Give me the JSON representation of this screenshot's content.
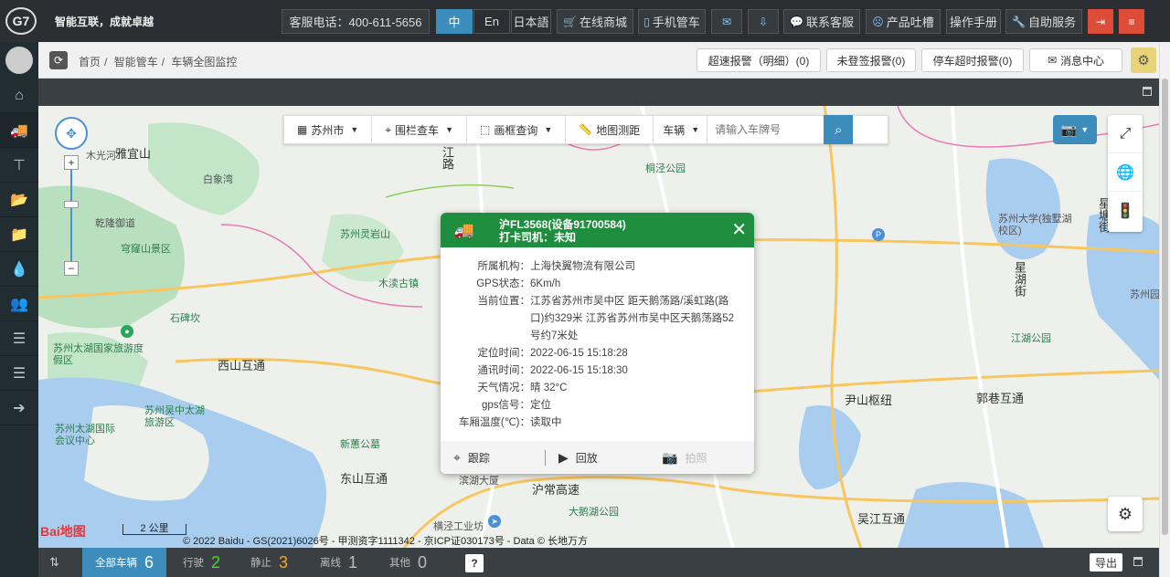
{
  "header": {
    "logo": "G7",
    "slogan": "智能互联，成就卓越",
    "phone": "客服电话：400-611-5656",
    "lang": [
      "中",
      "En",
      "日本語"
    ],
    "buttons": [
      {
        "label": "在线商城",
        "icon": "cart-icon"
      },
      {
        "label": "手机管车",
        "icon": "mobile-icon"
      },
      {
        "label": "",
        "icon": "mail-icon"
      },
      {
        "label": "",
        "icon": "download-icon"
      },
      {
        "label": "联系客服",
        "icon": "chat-icon"
      },
      {
        "label": "产品吐槽",
        "icon": "frown-icon"
      },
      {
        "label": "操作手册",
        "icon": ""
      },
      {
        "label": "自助服务",
        "icon": "wrench-icon"
      }
    ]
  },
  "breadcrumb": [
    "首页",
    "智能管车",
    "车辆全图监控"
  ],
  "alarms": {
    "speeding": "超速报警（明细）(0)",
    "not_logged": "未登签报警(0)",
    "parking": "停车超时报警(0)",
    "messages": "消息中心"
  },
  "map_toolbar": {
    "city": "苏州市",
    "fence": "围栏查车",
    "box": "画框查询",
    "measure": "地图测距",
    "type": "车辆",
    "search_placeholder": "请输入车牌号"
  },
  "map_labels": [
    "雅宜山",
    "白象湾",
    "乾隆御道",
    "穹窿山景区",
    "苏州灵岩山",
    "木渎古镇",
    "石碑坎",
    "苏州太湖国家旅游度假区",
    "西山互通",
    "苏州吴中太湖旅游区",
    "苏州太湖国际会议中心",
    "新蕙公墓",
    "东山互通",
    "滨湖大厦",
    "沪常高速",
    "大鹅湖公园",
    "横泾工业坊",
    "桐泾公园",
    "苏州大学(独墅湖校区)",
    "星湖街",
    "江湖公园",
    "尹山枢纽",
    "郭巷互通",
    "吴江互通",
    "星塘街",
    "苏州园",
    "木光河",
    "江路"
  ],
  "popup": {
    "plate": "沪FL3568(设备91700584)",
    "driver": "打卡司机：未知",
    "rows": [
      {
        "k": "所属机构：",
        "v": "上海快翼物流有限公司"
      },
      {
        "k": "GPS状态：",
        "v": "6Km/h"
      },
      {
        "k": "当前位置：",
        "v": "江苏省苏州市吴中区 距天鹅荡路/溪虹路(路口)约329米 江苏省苏州市吴中区天鹅荡路52号约7米处"
      },
      {
        "k": "定位时间：",
        "v": "2022-06-15 15:18:28"
      },
      {
        "k": "通讯时间：",
        "v": "2022-06-15 15:18:30"
      },
      {
        "k": "天气情况：",
        "v": "晴 32°C"
      },
      {
        "k": "gps信号：",
        "v": "定位"
      },
      {
        "k": "车厢温度(℃)：",
        "v": "读取中"
      }
    ],
    "actions": {
      "track": "跟踪",
      "playback": "回放",
      "photo": "拍照"
    }
  },
  "map_footer": {
    "scale": "2 公里",
    "baidu_logo": "Bai地图",
    "copyright": "© 2022 Baidu - GS(2021)6026号 - 甲测资字1111342 - 京ICP证030173号 - Data © 长地万方"
  },
  "bottom": {
    "stats": [
      {
        "label": "全部车辆",
        "n": "6",
        "color": "#ffffff"
      },
      {
        "label": "行驶",
        "n": "2",
        "color": "#4cd137"
      },
      {
        "label": "静止",
        "n": "3",
        "color": "#f5a623"
      },
      {
        "label": "离线",
        "n": "1",
        "color": "#bbbbbb"
      },
      {
        "label": "其他",
        "n": "0",
        "color": "#bbbbbb"
      }
    ],
    "help": "?",
    "export": "导出"
  }
}
